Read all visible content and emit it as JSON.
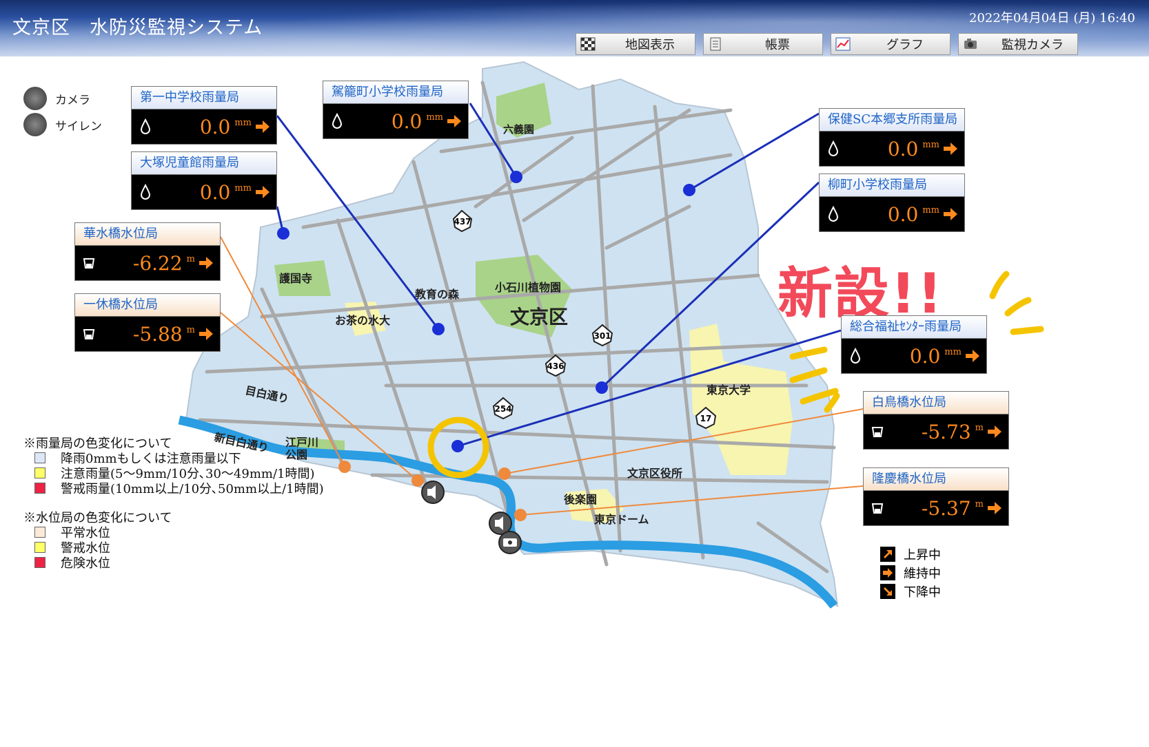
{
  "header": {
    "title": "文京区　水防災監視システム",
    "datetime": "2022年04月04日 (月) 16:40",
    "nav": [
      {
        "label": "地図表示",
        "icon": "grid-map-icon"
      },
      {
        "label": "帳票",
        "icon": "document-icon"
      },
      {
        "label": "グラフ",
        "icon": "graph-icon"
      },
      {
        "label": "監視カメラ",
        "icon": "camera-icon"
      }
    ]
  },
  "legend_top": {
    "camera": "カメラ",
    "siren": "サイレン"
  },
  "rain_stations": [
    {
      "name": "第一中学校雨量局",
      "value": "0.0",
      "unit": "mm"
    },
    {
      "name": "駕籠町小学校雨量局",
      "value": "0.0",
      "unit": "mm"
    },
    {
      "name": "大塚児童館雨量局",
      "value": "0.0",
      "unit": "mm"
    },
    {
      "name": "保健SC本郷支所雨量局",
      "value": "0.0",
      "unit": "mm"
    },
    {
      "name": "柳町小学校雨量局",
      "value": "0.0",
      "unit": "mm"
    },
    {
      "name": "総合福祉ｾﾝﾀｰ雨量局",
      "value": "0.0",
      "unit": "mm"
    }
  ],
  "water_stations": [
    {
      "name": "華水橋水位局",
      "value": "-6.22",
      "unit": "m"
    },
    {
      "name": "一休橋水位局",
      "value": "-5.88",
      "unit": "m"
    },
    {
      "name": "白鳥橋水位局",
      "value": "-5.73",
      "unit": "m"
    },
    {
      "name": "隆慶橋水位局",
      "value": "-5.37",
      "unit": "m"
    }
  ],
  "map_labels": {
    "district": "文京区",
    "rikugien": "六義園",
    "koishikawa": "小石川植物園",
    "gokokuji": "護国寺",
    "kyoiku": "教育の森",
    "ochanomizu": "お茶の水大",
    "mejiro": "目白通り",
    "shinmejiro": "新目白通り",
    "edogawa": "江戸川\n公園",
    "todai": "東京大学",
    "kuyakusho": "文京区役所",
    "korakuen": "後楽園",
    "dome": "東京ドーム",
    "r437": "437",
    "r301": "301",
    "r436": "436",
    "r254": "254",
    "r17": "17"
  },
  "annotation": {
    "new_text": "新設!!",
    "color": "#f24a5a",
    "highlight": "#f5c400"
  },
  "rain_legend": {
    "title": "※雨量局の色変化について",
    "items": [
      {
        "label": "降雨0mmもしくは注意雨量以下",
        "color": "#dde7f7"
      },
      {
        "label": "注意雨量(5〜9mm/10分､30〜49mm/1時間)",
        "color": "#ffff66"
      },
      {
        "label": "警戒雨量(10mm以上/10分､50mm以上/1時間)",
        "color": "#ee2244"
      }
    ]
  },
  "water_legend": {
    "title": "※水位局の色変化について",
    "items": [
      {
        "label": "平常水位",
        "color": "#fbead8"
      },
      {
        "label": "警戒水位",
        "color": "#ffff66"
      },
      {
        "label": "危険水位",
        "color": "#ee2244"
      }
    ]
  },
  "trend_legend": [
    {
      "label": "上昇中",
      "icon": "arrow-up-right-icon"
    },
    {
      "label": "維持中",
      "icon": "arrow-right-icon"
    },
    {
      "label": "下降中",
      "icon": "arrow-down-right-icon"
    }
  ]
}
